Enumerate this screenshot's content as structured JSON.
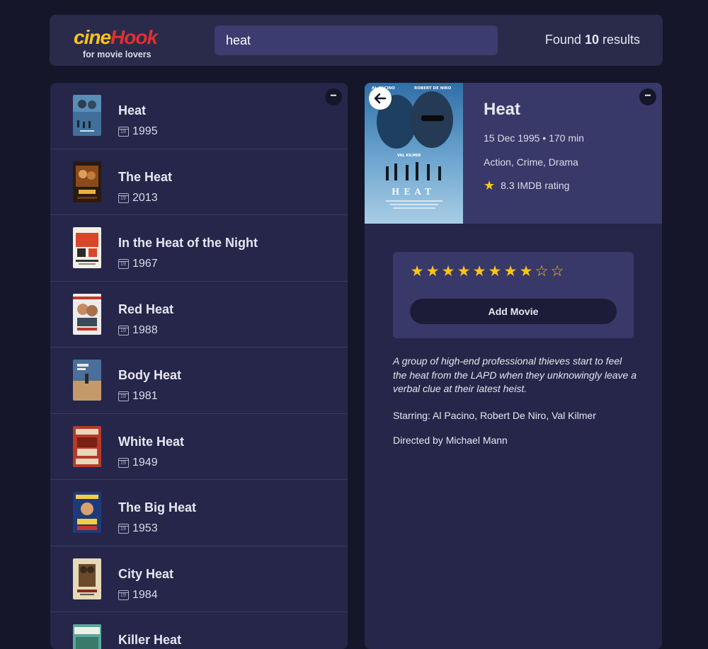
{
  "app": {
    "logo_part1": "cine",
    "logo_part2": "Hook",
    "tagline": "for movie lovers",
    "colors": {
      "background": "#16162b",
      "panel": "#26264a",
      "accent_yellow": "#fcc419",
      "accent_red": "#e03131"
    }
  },
  "search": {
    "value": "heat"
  },
  "results": {
    "prefix": "Found",
    "count": "10",
    "suffix": "results"
  },
  "movies": [
    {
      "title": "Heat",
      "year": "1995"
    },
    {
      "title": "The Heat",
      "year": "2013"
    },
    {
      "title": "In the Heat of the Night",
      "year": "1967"
    },
    {
      "title": "Red Heat",
      "year": "1988"
    },
    {
      "title": "Body Heat",
      "year": "1981"
    },
    {
      "title": "White Heat",
      "year": "1949"
    },
    {
      "title": "The Big Heat",
      "year": "1953"
    },
    {
      "title": "City Heat",
      "year": "1984"
    },
    {
      "title": "Killer Heat",
      "year": ""
    }
  ],
  "icons": {
    "collapse": "minus-icon",
    "back": "arrow-left-icon",
    "year": "calendar-icon",
    "imdb": "star-icon"
  },
  "details": {
    "title": "Heat",
    "date": "15 Dec 1995",
    "separator": "•",
    "runtime": "170 min",
    "genres": "Action, Crime, Drama",
    "imdb_rating": "8.3",
    "imdb_suffix": "IMDB rating",
    "poster": {
      "credit_left": "AL PACINO",
      "credit_right": "ROBERT DE NIRO",
      "credit_mid": "VAL KILMER",
      "title": "HEAT"
    },
    "user_rating": {
      "value": 8,
      "max": 10
    },
    "add_button_label": "Add Movie",
    "plot": "A group of high-end professional thieves start to feel the heat from the LAPD when they unknowingly leave a verbal clue at their latest heist.",
    "starring": "Starring: Al Pacino, Robert De Niro, Val Kilmer",
    "director": "Directed by Michael Mann"
  }
}
